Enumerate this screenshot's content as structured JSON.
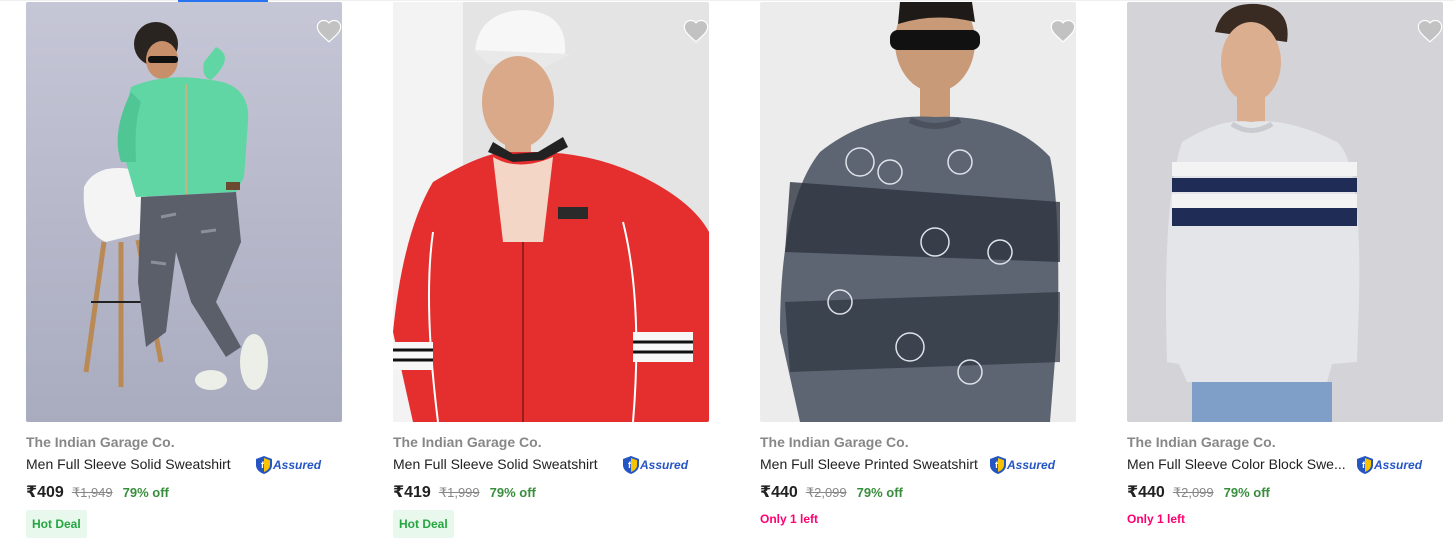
{
  "products": [
    {
      "brand": "The Indian Garage Co.",
      "title": "Men Full Sleeve Solid Sweatshirt",
      "assured": "Assured",
      "price": "₹409",
      "mrp": "₹1,949",
      "discount": "79% off",
      "tag": "Hot Deal",
      "stock_note": "",
      "wishlist_icon": "heart-icon",
      "image_desc": "man in mint green sweatshirt and grey ripped jeans beside white chair"
    },
    {
      "brand": "The Indian Garage Co.",
      "title": "Men Full Sleeve Solid Sweatshirt",
      "assured": "Assured",
      "price": "₹419",
      "mrp": "₹1,999",
      "discount": "79% off",
      "tag": "Hot Deal",
      "stock_note": "",
      "wishlist_icon": "heart-icon",
      "image_desc": "man in white cap and red zip bomber sweatshirt"
    },
    {
      "brand": "The Indian Garage Co.",
      "title": "Men Full Sleeve Printed Sweatshirt",
      "assured": "Assured",
      "price": "₹440",
      "mrp": "₹2,099",
      "discount": "79% off",
      "tag": "",
      "stock_note": "Only 1 left",
      "wishlist_icon": "heart-icon",
      "image_desc": "man in sunglasses and grey printed smiley sweatshirt"
    },
    {
      "brand": "The Indian Garage Co.",
      "title": "Men Full Sleeve Color Block Swe...",
      "assured": "Assured",
      "price": "₹440",
      "mrp": "₹2,099",
      "discount": "79% off",
      "tag": "",
      "stock_note": "Only 1 left",
      "wishlist_icon": "heart-icon",
      "image_desc": "man in grey sweatshirt with navy and white chest stripes"
    }
  ],
  "colors": {
    "accent_blue": "#2874f0",
    "discount_green": "#388e3c",
    "deal_bg": "#e8f8ec",
    "deal_text": "#26a541",
    "stock_pink": "#ff0070",
    "muted": "#878787"
  }
}
